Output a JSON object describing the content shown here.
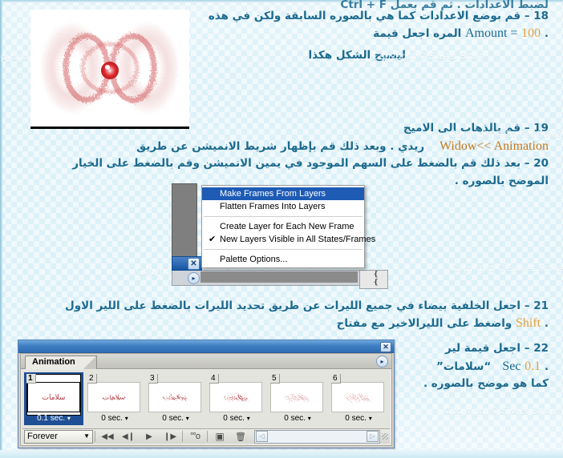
{
  "page": {
    "bg_color": "#ddf1f9",
    "accent_text_color": "#1d6a8f",
    "highlight_color": "#e8a33d"
  },
  "tutorial": {
    "line_top": "لضبط الاعدادات . ثم قم بعمل Ctrl + F",
    "step18_line1": "18 – قم بوضع الاعدادات كما هي بالصوره السابقة ولكن في هذه",
    "step18_line2_pre": "المره اجعل قيمة",
    "step18_amount_value": "100",
    "step18_amount_label": "Amount =",
    "step18_line2_end": ".",
    "step18_result": "ليصبح الشكل هكذا",
    "step19_line1": "19 – قم بالذهاب الى الاميج",
    "step19_line2_pre": "ريدي . وبعد ذلك قم بإظهار شريط الانميشن عن طريق",
    "step19_menu_path": "Widow<< Animation",
    "step20_line1": "20 – بعد ذلك قم بالضغط على السهم الموجود في يمين الانميشن وقم بالضغط على الخيار",
    "step20_line2": "الموضح بالصوره .",
    "step21_line1": "21 – اجعل الخلفية بيضاء في جميع الليرات عن طريق تحديد الليرات بالضغط على اللير الاول",
    "step21_line2_pre": "واضغط على الليرالاخير مع مفتاح",
    "step21_shift": "Shift",
    "step21_line2_end": ".",
    "step22_line1": "22 – اجعل قيمة لير",
    "step22_line2_word": "سلامات",
    "step22_sec_value": "0.1",
    "step22_sec_unit": "Sec",
    "step22_line2_end": ".",
    "step22_line3": "كما هو موضح بالصوره ."
  },
  "watermark": {
    "text": "Copyright © Sweet Smile",
    "text_short": "opyrigh",
    "instances": 6
  },
  "photoshop_menu": {
    "items": [
      {
        "label": "Make Frames From Layers",
        "selected": true,
        "checked": false
      },
      {
        "label": "Flatten Frames Into Layers",
        "selected": false,
        "checked": false
      },
      {
        "separator_after": true
      },
      {
        "label": "Create Layer for Each New Frame",
        "selected": false,
        "checked": false
      },
      {
        "label": "New Layers Visible in All States/Frames",
        "selected": false,
        "checked": true
      },
      {
        "separator_after": true
      },
      {
        "label": "Palette Options...",
        "selected": false,
        "checked": false
      }
    ],
    "check_glyph": "✔",
    "close_glyph": "✕",
    "scroll_glyph": "▸"
  },
  "animation_panel": {
    "window_title": "",
    "close_glyph": "✕",
    "tab_label": "Animation",
    "tab_arrow_glyph": "▸",
    "frames": [
      {
        "number": "1",
        "delay": "0.1 sec.",
        "word": "سلامات",
        "scatter": 0,
        "active": true
      },
      {
        "number": "2",
        "delay": "0 sec.",
        "word": "سلامات",
        "scatter": 1,
        "active": false
      },
      {
        "number": "3",
        "delay": "0 sec.",
        "word": "سلامات",
        "scatter": 2,
        "active": false
      },
      {
        "number": "4",
        "delay": "0 sec.",
        "word": "سلامات",
        "scatter": 3,
        "active": false
      },
      {
        "number": "5",
        "delay": "0 sec.",
        "word": "سلامات",
        "scatter": 4,
        "active": false
      },
      {
        "number": "6",
        "delay": "0 sec.",
        "word": "سلامات",
        "scatter": 5,
        "active": false
      }
    ],
    "delay_caret": "▾",
    "loop_value": "Forever",
    "loop_caret": "▼",
    "toolbar_buttons": [
      {
        "name": "select-first-frame",
        "glyph": "◀◀"
      },
      {
        "name": "select-previous-frame",
        "glyph": "◀❙"
      },
      {
        "name": "play-animation",
        "glyph": "▶"
      },
      {
        "name": "select-next-frame",
        "glyph": "❙▶"
      },
      {
        "name": "tween-frames",
        "glyph": "°°o"
      },
      {
        "name": "duplicate-frame",
        "glyph": "▣"
      },
      {
        "name": "delete-frame",
        "glyph": "🗑"
      }
    ],
    "scroll_left_glyph": "◁",
    "scroll_right_glyph": "▷"
  },
  "preview_image": {
    "description": "red radial blur / scatter effect on white background"
  }
}
